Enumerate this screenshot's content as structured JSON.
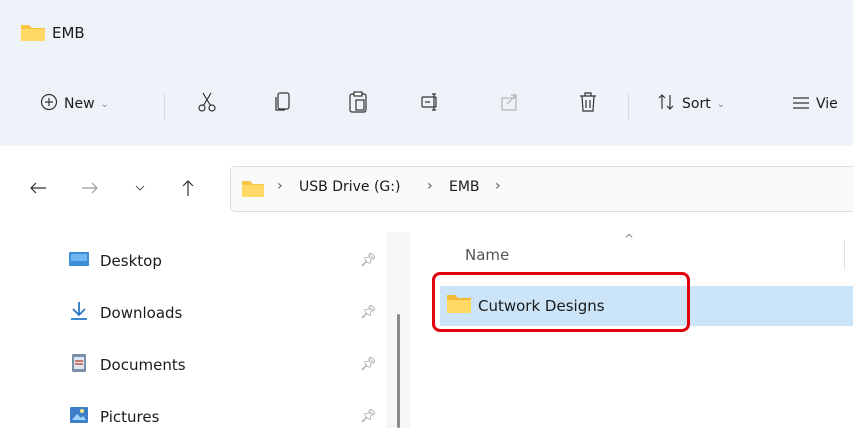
{
  "window": {
    "title": "EMB"
  },
  "toolbar": {
    "new_label": "New",
    "sort_label": "Sort",
    "view_label": "Vie"
  },
  "address": {
    "crumbs": [
      "USB Drive (G:)",
      "EMB"
    ]
  },
  "sidebar": {
    "items": [
      {
        "label": "Desktop",
        "icon": "desktop-icon"
      },
      {
        "label": "Downloads",
        "icon": "download-icon"
      },
      {
        "label": "Documents",
        "icon": "documents-icon"
      },
      {
        "label": "Pictures",
        "icon": "pictures-icon"
      }
    ]
  },
  "content": {
    "column_name": "Name",
    "rows": [
      {
        "label": "Cutwork Designs",
        "selected": true
      }
    ]
  },
  "colors": {
    "accent_selection": "#cce4f7",
    "highlight_box": "#e0000b",
    "folder_yellow": "#f7c542"
  }
}
